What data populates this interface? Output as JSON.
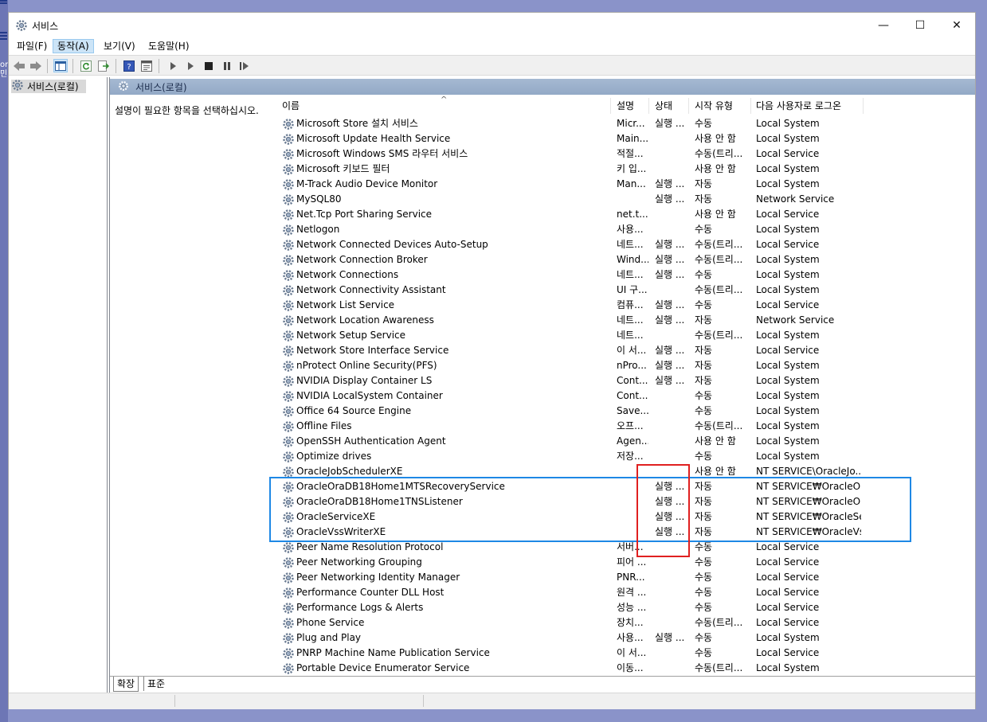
{
  "desktop": {
    "fragments": [
      "or",
      "민"
    ]
  },
  "window": {
    "title": "서비스",
    "controls": {
      "minimize": "—",
      "maximize": "☐",
      "close": "✕"
    }
  },
  "menubar": [
    {
      "label": "파일(F)"
    },
    {
      "label": "동작(A)"
    },
    {
      "label": "보기(V)"
    },
    {
      "label": "도움말(H)"
    }
  ],
  "tree": {
    "root_label": "서비스(로컬)"
  },
  "pane": {
    "header": "서비스(로컬)",
    "description": "설명이 필요한 항목을 선택하십시오."
  },
  "columns": {
    "name": "이름",
    "desc": "설명",
    "status": "상태",
    "startup": "시작 유형",
    "logon": "다음 사용자로 로그온"
  },
  "rows": [
    {
      "name": "Microsoft Store 설치 서비스",
      "desc": "Micr...",
      "status": "실행 ...",
      "startup": "수동",
      "logon": "Local System"
    },
    {
      "name": "Microsoft Update Health Service",
      "desc": "Main...",
      "status": "",
      "startup": "사용 안 함",
      "logon": "Local System"
    },
    {
      "name": "Microsoft Windows SMS 라우터 서비스",
      "desc": "적절...",
      "status": "",
      "startup": "수동(트리...",
      "logon": "Local Service"
    },
    {
      "name": "Microsoft 키보드 필터",
      "desc": "키 입...",
      "status": "",
      "startup": "사용 안 함",
      "logon": "Local System"
    },
    {
      "name": "M-Track Audio Device Monitor",
      "desc": "Man...",
      "status": "실행 ...",
      "startup": "자동",
      "logon": "Local System"
    },
    {
      "name": "MySQL80",
      "desc": "",
      "status": "실행 ...",
      "startup": "자동",
      "logon": "Network Service"
    },
    {
      "name": "Net.Tcp Port Sharing Service",
      "desc": "net.t...",
      "status": "",
      "startup": "사용 안 함",
      "logon": "Local Service"
    },
    {
      "name": "Netlogon",
      "desc": "사용...",
      "status": "",
      "startup": "수동",
      "logon": "Local System"
    },
    {
      "name": "Network Connected Devices Auto-Setup",
      "desc": "네트...",
      "status": "실행 ...",
      "startup": "수동(트리...",
      "logon": "Local Service"
    },
    {
      "name": "Network Connection Broker",
      "desc": "Wind...",
      "status": "실행 ...",
      "startup": "수동(트리...",
      "logon": "Local System"
    },
    {
      "name": "Network Connections",
      "desc": "네트...",
      "status": "실행 ...",
      "startup": "수동",
      "logon": "Local System"
    },
    {
      "name": "Network Connectivity Assistant",
      "desc": "UI 구...",
      "status": "",
      "startup": "수동(트리...",
      "logon": "Local System"
    },
    {
      "name": "Network List Service",
      "desc": "컴퓨...",
      "status": "실행 ...",
      "startup": "수동",
      "logon": "Local Service"
    },
    {
      "name": "Network Location Awareness",
      "desc": "네트...",
      "status": "실행 ...",
      "startup": "자동",
      "logon": "Network Service"
    },
    {
      "name": "Network Setup Service",
      "desc": "네트...",
      "status": "",
      "startup": "수동(트리...",
      "logon": "Local System"
    },
    {
      "name": "Network Store Interface Service",
      "desc": "이 서...",
      "status": "실행 ...",
      "startup": "자동",
      "logon": "Local Service"
    },
    {
      "name": "nProtect Online Security(PFS)",
      "desc": "nPro...",
      "status": "실행 ...",
      "startup": "자동",
      "logon": "Local System"
    },
    {
      "name": "NVIDIA Display Container LS",
      "desc": "Cont...",
      "status": "실행 ...",
      "startup": "자동",
      "logon": "Local System"
    },
    {
      "name": "NVIDIA LocalSystem Container",
      "desc": "Cont...",
      "status": "",
      "startup": "수동",
      "logon": "Local System"
    },
    {
      "name": "Office 64 Source Engine",
      "desc": "Save...",
      "status": "",
      "startup": "수동",
      "logon": "Local System"
    },
    {
      "name": "Offline Files",
      "desc": "오프...",
      "status": "",
      "startup": "수동(트리...",
      "logon": "Local System"
    },
    {
      "name": "OpenSSH Authentication Agent",
      "desc": "Agen...",
      "status": "",
      "startup": "사용 안 함",
      "logon": "Local System"
    },
    {
      "name": "Optimize drives",
      "desc": "저장...",
      "status": "",
      "startup": "수동",
      "logon": "Local System"
    },
    {
      "name": "OracleJobSchedulerXE",
      "desc": "",
      "status": "",
      "startup": "사용 안 함",
      "logon": "NT SERVICE\\OracleJo..."
    },
    {
      "name": "OracleOraDB18Home1MTSRecoveryService",
      "desc": "",
      "status": "실행 ...",
      "startup": "자동",
      "logon": "NT SERVICE₩OracleOr..."
    },
    {
      "name": "OracleOraDB18Home1TNSListener",
      "desc": "",
      "status": "실행 ...",
      "startup": "자동",
      "logon": "NT SERVICE₩OracleOr..."
    },
    {
      "name": "OracleServiceXE",
      "desc": "",
      "status": "실행 ...",
      "startup": "자동",
      "logon": "NT SERVICE₩OracleSe..."
    },
    {
      "name": "OracleVssWriterXE",
      "desc": "",
      "status": "실행 ...",
      "startup": "자동",
      "logon": "NT SERVICE₩OracleVs..."
    },
    {
      "name": "Peer Name Resolution Protocol",
      "desc": "서버...",
      "status": "",
      "startup": "수동",
      "logon": "Local Service"
    },
    {
      "name": "Peer Networking Grouping",
      "desc": "피어 ...",
      "status": "",
      "startup": "수동",
      "logon": "Local Service"
    },
    {
      "name": "Peer Networking Identity Manager",
      "desc": "PNR...",
      "status": "",
      "startup": "수동",
      "logon": "Local Service"
    },
    {
      "name": "Performance Counter DLL Host",
      "desc": "원격 ...",
      "status": "",
      "startup": "수동",
      "logon": "Local Service"
    },
    {
      "name": "Performance Logs & Alerts",
      "desc": "성능 ...",
      "status": "",
      "startup": "수동",
      "logon": "Local Service"
    },
    {
      "name": "Phone Service",
      "desc": "장치...",
      "status": "",
      "startup": "수동(트리...",
      "logon": "Local Service"
    },
    {
      "name": "Plug and Play",
      "desc": "사용...",
      "status": "실행 ...",
      "startup": "수동",
      "logon": "Local System"
    },
    {
      "name": "PNRP Machine Name Publication Service",
      "desc": "이 서...",
      "status": "",
      "startup": "수동",
      "logon": "Local Service"
    },
    {
      "name": "Portable Device Enumerator Service",
      "desc": "이동...",
      "status": "",
      "startup": "수동(트리...",
      "logon": "Local System"
    }
  ],
  "tabs": [
    {
      "label": "확장"
    },
    {
      "label": "표준"
    }
  ],
  "colors": {
    "highlight_blue": "#1e88e5",
    "highlight_red": "#e02020",
    "pane_header": "#a5b9d2"
  }
}
